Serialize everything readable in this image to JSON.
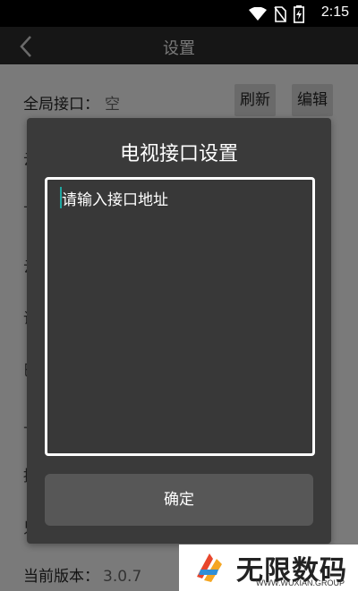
{
  "status_bar": {
    "time": "2:15",
    "icons": [
      "wifi-icon",
      "no-sim-icon",
      "battery-charging-icon"
    ]
  },
  "app_bar": {
    "title": "设置",
    "back_icon": "back-arrow-icon"
  },
  "settings": {
    "global_interface_label": "全局接口：",
    "global_interface_value": "空",
    "refresh_label": "刷新",
    "edit_label": "编辑",
    "version_label": "当前版本：",
    "version_value": "3.0.7",
    "partial_row_glyphs": [
      "云",
      "下",
      "云",
      "说",
      "巴",
      "上",
      "播",
      "只"
    ]
  },
  "dialog": {
    "title": "电视接口设置",
    "input_placeholder": "请输入接口地址",
    "confirm_label": "确定"
  },
  "watermark": {
    "text": "无限数码",
    "sub": "WWW.WUXIAN.GROUP"
  },
  "colors": {
    "dialog_bg": "#3a3a3a",
    "caret": "#1fa6a0",
    "scrim": "#7a7a7a"
  }
}
